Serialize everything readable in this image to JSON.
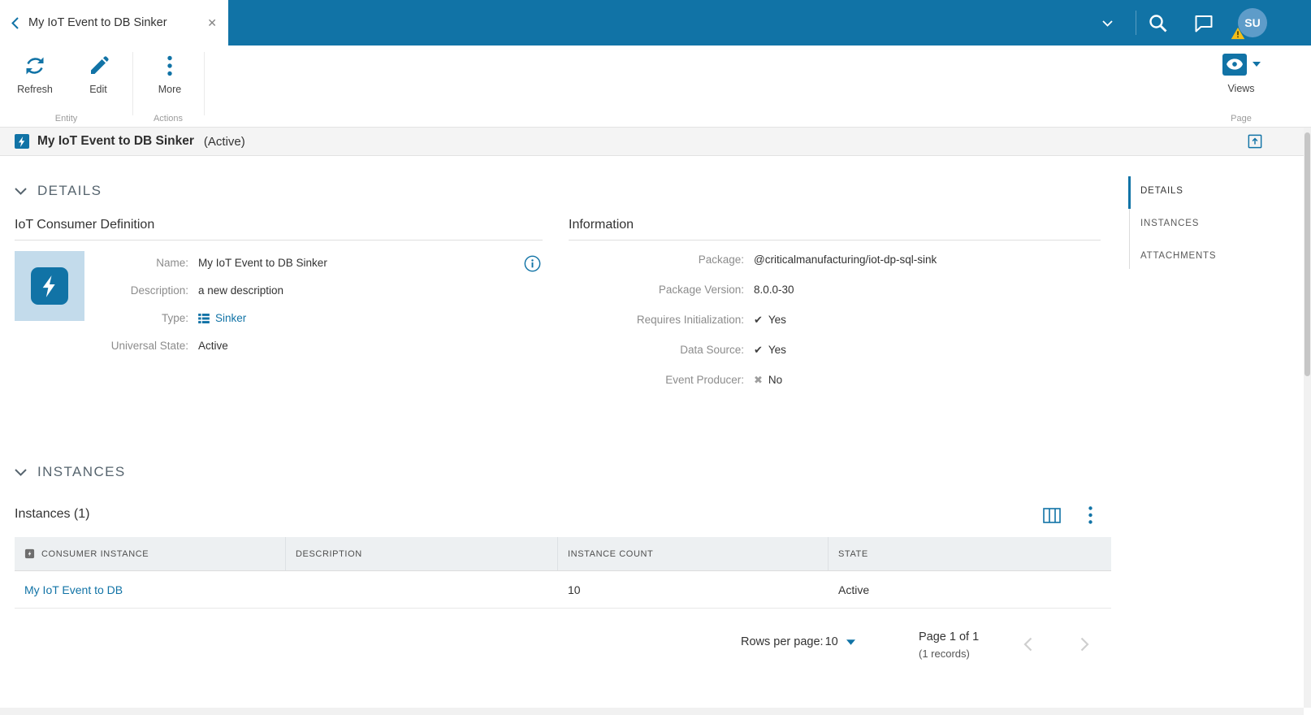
{
  "colors": {
    "accent": "#1173A6",
    "topbar": "#1173A6",
    "tile_bg": "#C3DBEB",
    "warning": "#F3BE17"
  },
  "topbar": {
    "tab": {
      "title": "My IoT Event to DB Sinker",
      "close": "✕"
    },
    "user_initials": "SU"
  },
  "toolbar": {
    "buttons": [
      {
        "label": "Refresh"
      },
      {
        "label": "Edit"
      },
      {
        "label": "More"
      }
    ],
    "groups": {
      "entity": "Entity",
      "actions": "Actions",
      "page": "Page"
    },
    "views_label": "Views"
  },
  "entity_header": {
    "title": "My IoT Event to DB Sinker",
    "state": "(Active)"
  },
  "side_nav": {
    "items": [
      {
        "label": "DETAILS"
      },
      {
        "label": "INSTANCES"
      },
      {
        "label": "ATTACHMENTS"
      }
    ]
  },
  "details": {
    "section_title": "DETAILS",
    "definition": {
      "title": "IoT Consumer Definition",
      "fields": [
        {
          "label": "Name:",
          "value": "My IoT Event to DB Sinker"
        },
        {
          "label": "Description:",
          "value": "a new description"
        },
        {
          "label": "Type:",
          "value": "Sinker"
        },
        {
          "label": "Universal State:",
          "value": "Active"
        }
      ]
    },
    "information": {
      "title": "Information",
      "fields": [
        {
          "label": "Package:",
          "value": "@criticalmanufacturing/iot-dp-sql-sink"
        },
        {
          "label": "Package Version:",
          "value": "8.0.0-30"
        },
        {
          "label": "Requires Initialization:",
          "icon_glyph": "✔",
          "value": "Yes"
        },
        {
          "label": "Data Source:",
          "icon_glyph": "✔",
          "value": "Yes"
        },
        {
          "label": "Event Producer:",
          "icon_glyph": "✖",
          "value": "No"
        }
      ]
    }
  },
  "instances": {
    "section_title": "INSTANCES",
    "table_title": "Instances (1)",
    "columns": [
      "CONSUMER INSTANCE",
      "DESCRIPTION",
      "INSTANCE COUNT",
      "STATE"
    ],
    "rows": [
      {
        "consumer_instance": "My IoT Event to DB",
        "description": "",
        "instance_count": "10",
        "state": "Active"
      }
    ],
    "pagination": {
      "rows_per_page_label": "Rows per page:",
      "rows_per_page_value": "10",
      "page_label": "Page 1 of 1",
      "records_label": "(1 records)"
    }
  }
}
